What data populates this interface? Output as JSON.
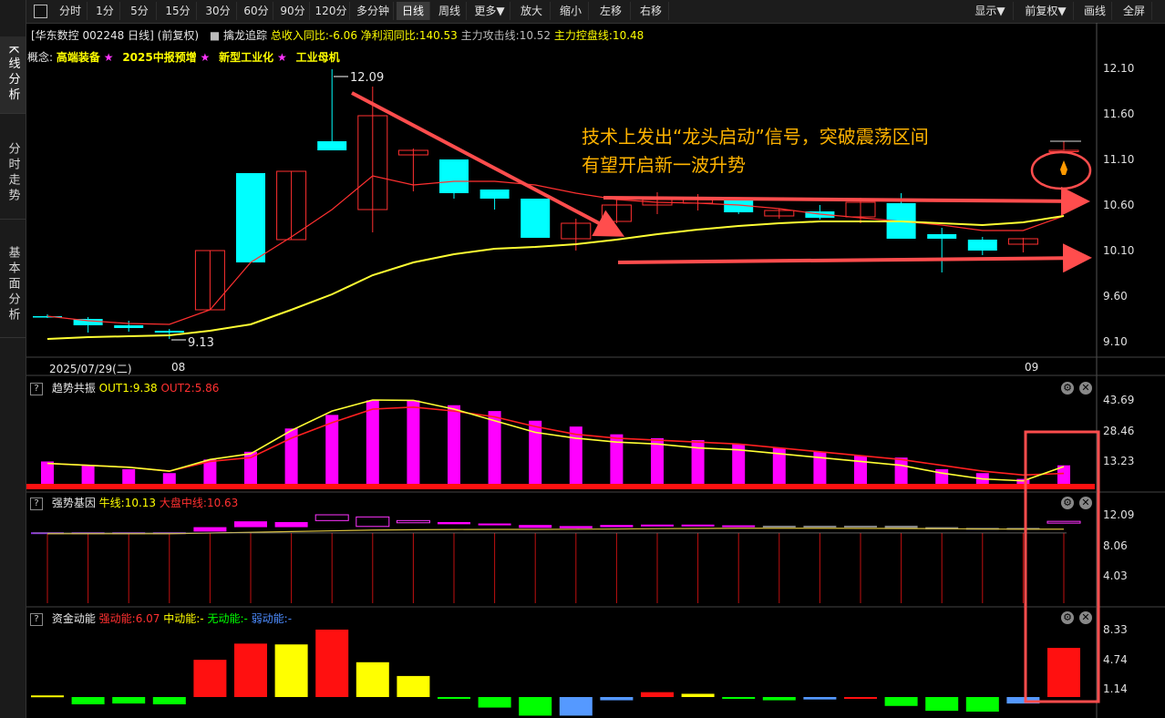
{
  "sidebar": {
    "tabs": [
      "K线分析",
      "分时走势",
      "基本面分析"
    ]
  },
  "toolbar": {
    "buttons": [
      "分时",
      "1分",
      "5分",
      "15分",
      "30分",
      "60分",
      "90分",
      "120分",
      "多分钟",
      "日线",
      "周线",
      "更多▼",
      "放大",
      "缩小",
      "左移",
      "右移"
    ],
    "right_buttons": [
      "显示▼",
      "前复权▼",
      "画线",
      "全屏"
    ],
    "active": "日线"
  },
  "stock": {
    "title": "[华东数控 002248 日线]",
    "adjust": "(前复权)",
    "indicator_name": "擒龙追踪",
    "revenue": "总收入同比:-6.06",
    "profit": "净利润同比:140.53",
    "attack": "主力攻击线:10.52",
    "control": "主力控盘线:10.48"
  },
  "concepts": {
    "label": "概念:",
    "items": [
      "高端装备",
      "2025中报预增",
      "新型工业化",
      "工业母机"
    ],
    "star": "★"
  },
  "annotation": {
    "line1": "技术上发出“龙头启动”信号，突破震荡区间",
    "line2": "有望开启新一波升势"
  },
  "price_axis": [
    "12.10",
    "11.60",
    "11.10",
    "10.60",
    "10.10",
    "9.60",
    "9.10"
  ],
  "date_axis": {
    "start": "2025/07/29(二)",
    "m1": "08",
    "m2": "09"
  },
  "extremes": {
    "high": "12.09",
    "low": "9.13"
  },
  "panels": {
    "trend": {
      "name": "趋势共振",
      "v1": "OUT1:9.38",
      "v2": "OUT2:5.86",
      "axis": [
        "43.69",
        "28.46",
        "13.23"
      ]
    },
    "gene": {
      "name": "强势基因",
      "v1": "牛线:10.13",
      "v2": "大盘中线:10.63",
      "axis": [
        "12.09",
        "8.06",
        "4.03"
      ]
    },
    "fund": {
      "name": "资金动能",
      "v1": "强动能:6.07",
      "v2": "中动能:-",
      "v3": "无动能:-",
      "v4": "弱动能:-",
      "axis": [
        "8.33",
        "4.74",
        "1.14"
      ]
    }
  },
  "colors": {
    "up": "#ff3030",
    "down": "#00ffff",
    "ma_short": "#ff3030",
    "ma_long": "#ffff33",
    "arrow": "#ff4d4d",
    "annotation": "#ffb300",
    "bar_magenta": "#ff00ff"
  },
  "chart_data": {
    "type": "candlestick",
    "ylim": [
      9.0,
      12.2
    ],
    "candles": [
      {
        "o": 9.38,
        "c": 9.38,
        "h": 9.4,
        "l": 9.36,
        "dir": "down"
      },
      {
        "o": 9.35,
        "c": 9.28,
        "h": 9.37,
        "l": 9.2,
        "dir": "down"
      },
      {
        "o": 9.28,
        "c": 9.25,
        "h": 9.33,
        "l": 9.21,
        "dir": "down"
      },
      {
        "o": 9.22,
        "c": 9.2,
        "h": 9.24,
        "l": 9.13,
        "dir": "down"
      },
      {
        "o": 9.45,
        "c": 10.1,
        "h": 10.1,
        "l": 9.45,
        "dir": "up"
      },
      {
        "o": 10.95,
        "c": 9.97,
        "h": 10.95,
        "l": 9.97,
        "dir": "down"
      },
      {
        "o": 10.22,
        "c": 10.97,
        "h": 10.97,
        "l": 10.22,
        "dir": "up"
      },
      {
        "o": 11.3,
        "c": 11.2,
        "h": 12.09,
        "l": 11.2,
        "dir": "down"
      },
      {
        "o": 10.55,
        "c": 11.58,
        "h": 11.9,
        "l": 10.3,
        "dir": "up"
      },
      {
        "o": 11.2,
        "c": 11.15,
        "h": 11.22,
        "l": 10.75,
        "dir": "up"
      },
      {
        "o": 11.1,
        "c": 10.73,
        "h": 11.1,
        "l": 10.67,
        "dir": "down"
      },
      {
        "o": 10.77,
        "c": 10.67,
        "h": 10.77,
        "l": 10.55,
        "dir": "down"
      },
      {
        "o": 10.67,
        "c": 10.24,
        "h": 10.67,
        "l": 10.24,
        "dir": "down"
      },
      {
        "o": 10.23,
        "c": 10.4,
        "h": 10.45,
        "l": 10.1,
        "dir": "up"
      },
      {
        "o": 10.42,
        "c": 10.6,
        "h": 10.66,
        "l": 10.4,
        "dir": "up"
      },
      {
        "o": 10.6,
        "c": 10.66,
        "h": 10.74,
        "l": 10.5,
        "dir": "up"
      },
      {
        "o": 10.67,
        "c": 10.62,
        "h": 10.72,
        "l": 10.54,
        "dir": "up"
      },
      {
        "o": 10.65,
        "c": 10.52,
        "h": 10.66,
        "l": 10.5,
        "dir": "down"
      },
      {
        "o": 10.54,
        "c": 10.48,
        "h": 10.56,
        "l": 10.45,
        "dir": "up"
      },
      {
        "o": 10.53,
        "c": 10.46,
        "h": 10.6,
        "l": 10.44,
        "dir": "down"
      },
      {
        "o": 10.47,
        "c": 10.63,
        "h": 10.68,
        "l": 10.4,
        "dir": "up"
      },
      {
        "o": 10.62,
        "c": 10.23,
        "h": 10.73,
        "l": 10.23,
        "dir": "down"
      },
      {
        "o": 10.28,
        "c": 10.23,
        "h": 10.35,
        "l": 9.86,
        "dir": "down"
      },
      {
        "o": 10.22,
        "c": 10.1,
        "h": 10.25,
        "l": 10.05,
        "dir": "down"
      },
      {
        "o": 10.17,
        "c": 10.23,
        "h": 10.24,
        "l": 10.08,
        "dir": "up"
      },
      {
        "o": 11.2,
        "c": 11.2,
        "h": 11.3,
        "l": 11.2,
        "dir": "up"
      }
    ],
    "ma_short": [
      9.38,
      9.33,
      9.3,
      9.29,
      9.45,
      9.97,
      10.25,
      10.55,
      10.92,
      10.82,
      10.86,
      10.86,
      10.82,
      10.73,
      10.66,
      10.63,
      10.62,
      10.6,
      10.56,
      10.5,
      10.46,
      10.42,
      10.38,
      10.32,
      10.32,
      10.48
    ],
    "ma_long": [
      9.13,
      9.15,
      9.16,
      9.17,
      9.22,
      9.29,
      9.45,
      9.62,
      9.83,
      9.97,
      10.06,
      10.12,
      10.14,
      10.17,
      10.22,
      10.28,
      10.33,
      10.37,
      10.4,
      10.42,
      10.42,
      10.42,
      10.4,
      10.38,
      10.41,
      10.48
    ],
    "trend_bars": [
      12,
      10,
      8,
      6,
      13,
      17,
      29,
      36,
      43.5,
      43.5,
      41,
      38,
      33,
      30,
      26,
      24,
      23,
      21,
      19,
      17,
      15,
      14,
      8,
      6,
      3,
      10
    ],
    "trend_out1": [
      11,
      10,
      9,
      7,
      13,
      16,
      28,
      38,
      43.69,
      43.5,
      39,
      33,
      27,
      24,
      22,
      21,
      19,
      18,
      16,
      14,
      12,
      10,
      6,
      3,
      2,
      9.38
    ],
    "trend_out2": [
      11,
      10,
      9,
      7,
      12,
      14,
      24,
      32,
      39,
      40,
      38,
      35,
      30,
      26,
      24,
      23,
      22,
      21,
      19,
      17,
      15,
      13,
      10,
      7,
      5,
      5.86
    ],
    "gene_bars": [
      {
        "lo": 9.6,
        "hi": 9.7,
        "t": "down"
      },
      {
        "lo": 9.6,
        "hi": 9.7,
        "t": "down"
      },
      {
        "lo": 9.6,
        "hi": 9.7,
        "t": "down"
      },
      {
        "lo": 9.6,
        "hi": 9.7,
        "t": "down"
      },
      {
        "lo": 9.8,
        "hi": 10.4,
        "t": "up"
      },
      {
        "lo": 10.4,
        "hi": 11.2,
        "t": "up"
      },
      {
        "lo": 10.4,
        "hi": 11.1,
        "t": "up"
      },
      {
        "lo": 11.3,
        "hi": 12.09,
        "t": "hollow"
      },
      {
        "lo": 10.5,
        "hi": 11.8,
        "t": "hollow"
      },
      {
        "lo": 11.0,
        "hi": 11.3,
        "t": "hollow"
      },
      {
        "lo": 10.8,
        "hi": 11.1,
        "t": "up"
      },
      {
        "lo": 10.7,
        "hi": 10.9,
        "t": "up"
      },
      {
        "lo": 10.3,
        "hi": 10.7,
        "t": "up"
      },
      {
        "lo": 10.25,
        "hi": 10.55,
        "t": "up"
      },
      {
        "lo": 10.4,
        "hi": 10.7,
        "t": "up"
      },
      {
        "lo": 10.5,
        "hi": 10.75,
        "t": "up"
      },
      {
        "lo": 10.5,
        "hi": 10.75,
        "t": "up"
      },
      {
        "lo": 10.45,
        "hi": 10.65,
        "t": "up"
      },
      {
        "lo": 10.4,
        "hi": 10.6,
        "t": "grey"
      },
      {
        "lo": 10.4,
        "hi": 10.6,
        "t": "grey"
      },
      {
        "lo": 10.4,
        "hi": 10.6,
        "t": "grey"
      },
      {
        "lo": 10.2,
        "hi": 10.6,
        "t": "grey"
      },
      {
        "lo": 10.1,
        "hi": 10.4,
        "t": "grey"
      },
      {
        "lo": 10.1,
        "hi": 10.3,
        "t": "grey"
      },
      {
        "lo": 10.1,
        "hi": 10.3,
        "t": "grey"
      },
      {
        "lo": 11.0,
        "hi": 11.2,
        "t": "hollow"
      }
    ],
    "gene_line": [
      9.5,
      9.5,
      9.5,
      9.5,
      9.6,
      9.7,
      9.8,
      9.9,
      10.0,
      10.05,
      10.08,
      10.1,
      10.1,
      10.12,
      10.15,
      10.2,
      10.22,
      10.25,
      10.25,
      10.25,
      10.24,
      10.22,
      10.2,
      10.15,
      10.13,
      10.13
    ],
    "fund_bars": [
      {
        "v": 0.2,
        "c": "yellow"
      },
      {
        "v": -0.9,
        "c": "green"
      },
      {
        "v": -0.8,
        "c": "green"
      },
      {
        "v": -0.9,
        "c": "green"
      },
      {
        "v": 4.6,
        "c": "red"
      },
      {
        "v": 6.6,
        "c": "red"
      },
      {
        "v": 6.5,
        "c": "yellow"
      },
      {
        "v": 8.33,
        "c": "red"
      },
      {
        "v": 4.3,
        "c": "yellow"
      },
      {
        "v": 2.6,
        "c": "yellow"
      },
      {
        "v": -0.2,
        "c": "green"
      },
      {
        "v": -1.3,
        "c": "green"
      },
      {
        "v": -2.3,
        "c": "green"
      },
      {
        "v": -2.3,
        "c": "blue"
      },
      {
        "v": -0.4,
        "c": "blue"
      },
      {
        "v": 0.6,
        "c": "red"
      },
      {
        "v": 0.4,
        "c": "yellow"
      },
      {
        "v": -0.2,
        "c": "green"
      },
      {
        "v": -0.4,
        "c": "green"
      },
      {
        "v": -0.3,
        "c": "blue"
      },
      {
        "v": -0.2,
        "c": "red"
      },
      {
        "v": -1.1,
        "c": "green"
      },
      {
        "v": -1.7,
        "c": "green"
      },
      {
        "v": -1.8,
        "c": "green"
      },
      {
        "v": -0.8,
        "c": "blue"
      },
      {
        "v": 6.07,
        "c": "red"
      }
    ]
  }
}
